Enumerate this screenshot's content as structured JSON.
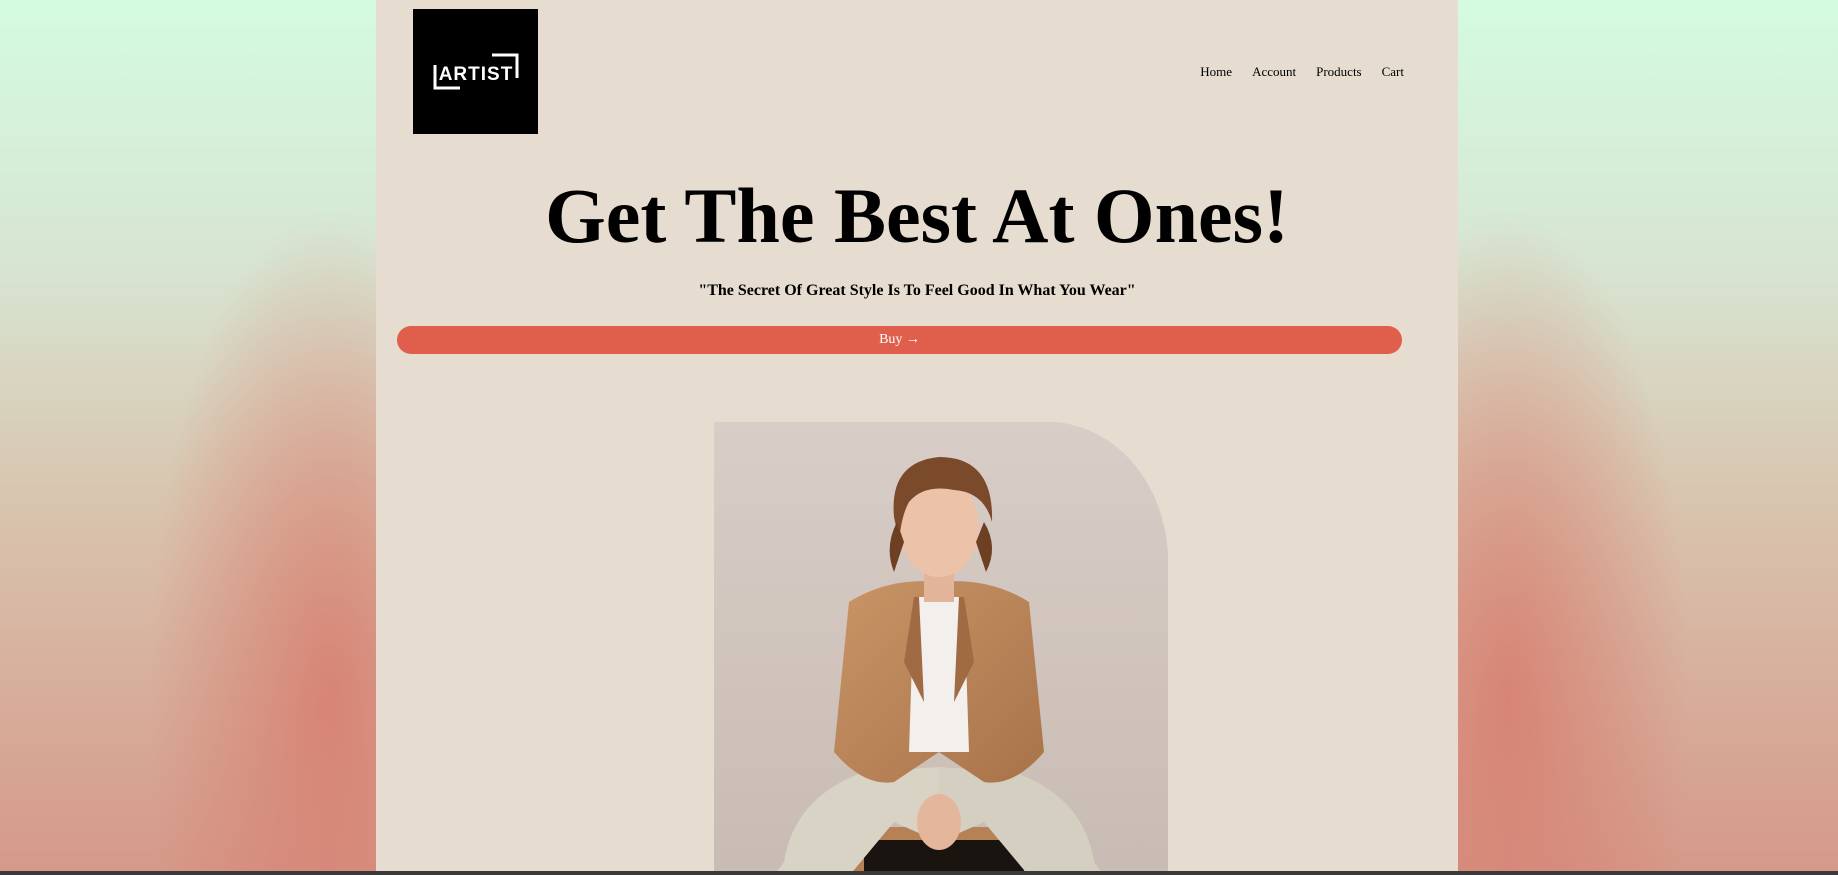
{
  "brand": {
    "logo_text": "ARTIST",
    "logo_background": "#000000",
    "logo_foreground": "#ffffff"
  },
  "nav": {
    "items": [
      {
        "label": "Home"
      },
      {
        "label": "Account"
      },
      {
        "label": "Products"
      },
      {
        "label": "Cart"
      }
    ]
  },
  "hero": {
    "title": "Get The Best At Ones!",
    "tagline": "\"The Secret Of Great Style Is To Feel Good In What You Wear\"",
    "buy_label": "Buy →",
    "buy_color": "#e05e4c"
  },
  "colors": {
    "page_background": "#e6dccf",
    "text": "#000000"
  }
}
